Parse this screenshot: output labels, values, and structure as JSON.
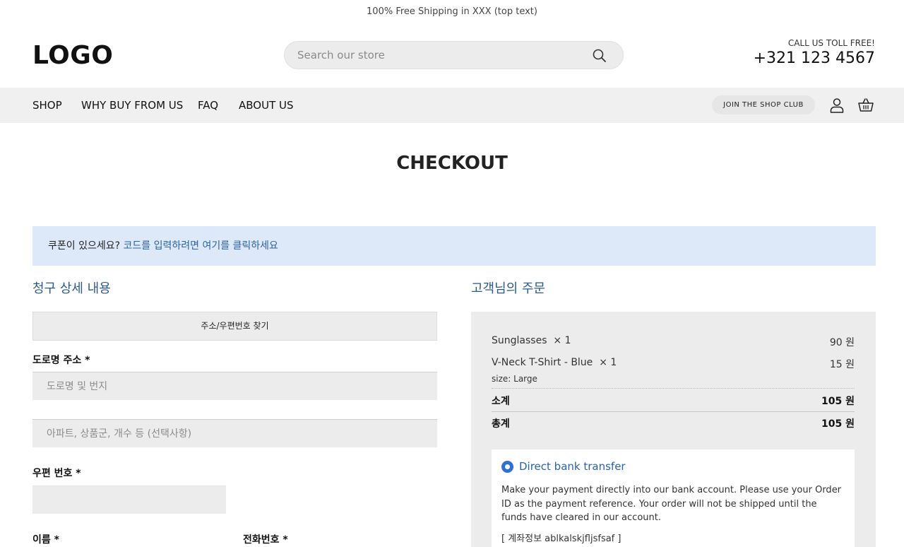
{
  "topbar": {
    "text": "100% Free Shipping in XXX (top text)"
  },
  "header": {
    "logo": "LOGO",
    "search_placeholder": "Search our store",
    "call_label": "CALL US TOLL FREE!",
    "phone": "+321 123 4567"
  },
  "nav": {
    "items": [
      "SHOP",
      "WHY BUY FROM US",
      "FAQ",
      "ABOUT US"
    ],
    "club": "JOIN THE SHOP CLUB"
  },
  "page": {
    "title": "CHECKOUT"
  },
  "notice": {
    "text": "쿠폰이 있으세요?",
    "link": "코드를 입력하려면 여기를 클릭하세요"
  },
  "billing": {
    "title": "청구 상세 내용",
    "address_search_button": "주소/우편번호 찾기",
    "street_label": "도로명 주소 *",
    "street_placeholder": "도로명 및 번지",
    "apt_placeholder": "아파트, 상품군, 개수 등 (선택사항)",
    "postcode_label": "우편 번호 *",
    "name_label": "이름 *",
    "phone_label": "전화번호 *"
  },
  "order": {
    "title": "고객님의 주문",
    "items": [
      {
        "name": "Sunglasses",
        "qty": "× 1",
        "price": "90 원"
      },
      {
        "name": "V-Neck T-Shirt - Blue",
        "qty": "× 1",
        "price": "15 원",
        "meta_label": "size:",
        "meta_value": "Large"
      }
    ],
    "subtotal_label": "소계",
    "subtotal": "105 원",
    "total_label": "총계",
    "total": "105 원"
  },
  "payment": {
    "method": "Direct bank transfer",
    "description": "Make your payment directly into our bank account. Please use your Order ID as the payment reference. Your order will not be shipped until the funds have cleared in our account.",
    "account": "[ 계좌정보 ablkalskjfljsfsaf ]"
  },
  "colors": {
    "accent": "#2b62a8",
    "heading": "#2b5a8a",
    "notice_bg": "#dde8f8",
    "nav_bg": "#f0f0f0"
  },
  "icons": [
    "search-icon",
    "user-icon",
    "basket-icon",
    "radio-selected-icon"
  ]
}
